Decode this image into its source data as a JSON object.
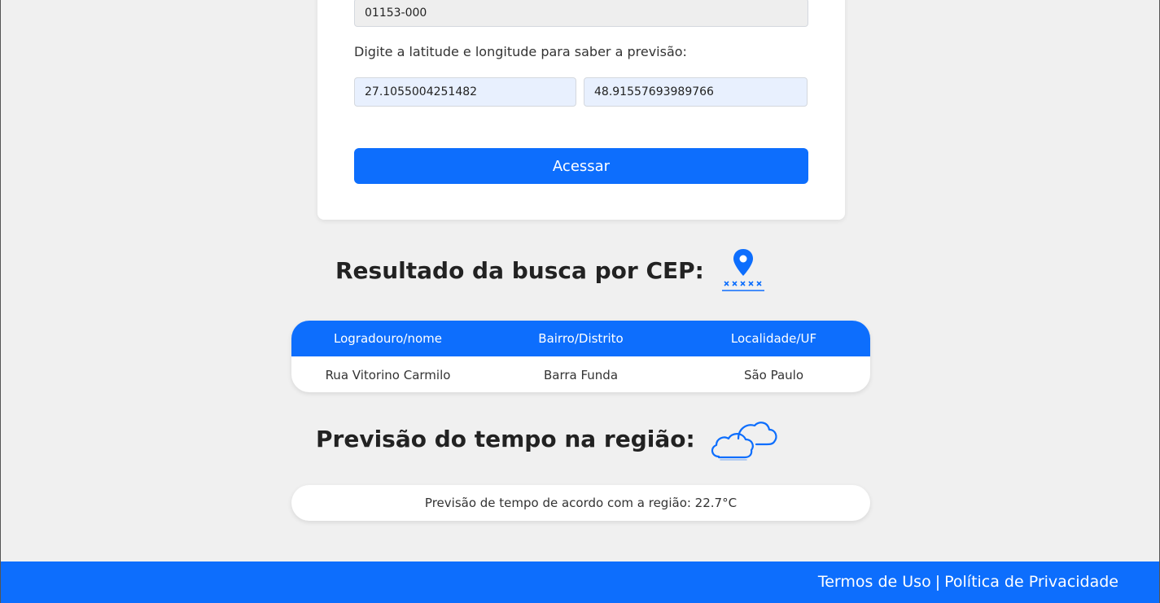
{
  "form": {
    "cep_value": "01153-000",
    "prompt": "Digite a latitude e longitude para saber a previsão:",
    "latitude_value": "27.1055004251482",
    "longitude_value": "48.91557693989766",
    "submit_label": "Acessar"
  },
  "cep_result": {
    "heading": "Resultado da busca por CEP:",
    "icon": "map-pin-icon",
    "headers": [
      "Logradouro/nome",
      "Bairro/Distrito",
      "Localidade/UF"
    ],
    "row": [
      "Rua Vitorino Carmilo",
      "Barra Funda",
      "São Paulo"
    ]
  },
  "weather": {
    "heading": "Previsão do tempo na região:",
    "icon": "cloud-icon",
    "text": "Previsão de tempo de acordo com a região: 22.7°C"
  },
  "footer": {
    "terms": "Termos de Uso",
    "separator": "|",
    "privacy": "Política de Privacidade"
  },
  "colors": {
    "primary": "#0d6efd",
    "background": "#f0f0f0"
  }
}
